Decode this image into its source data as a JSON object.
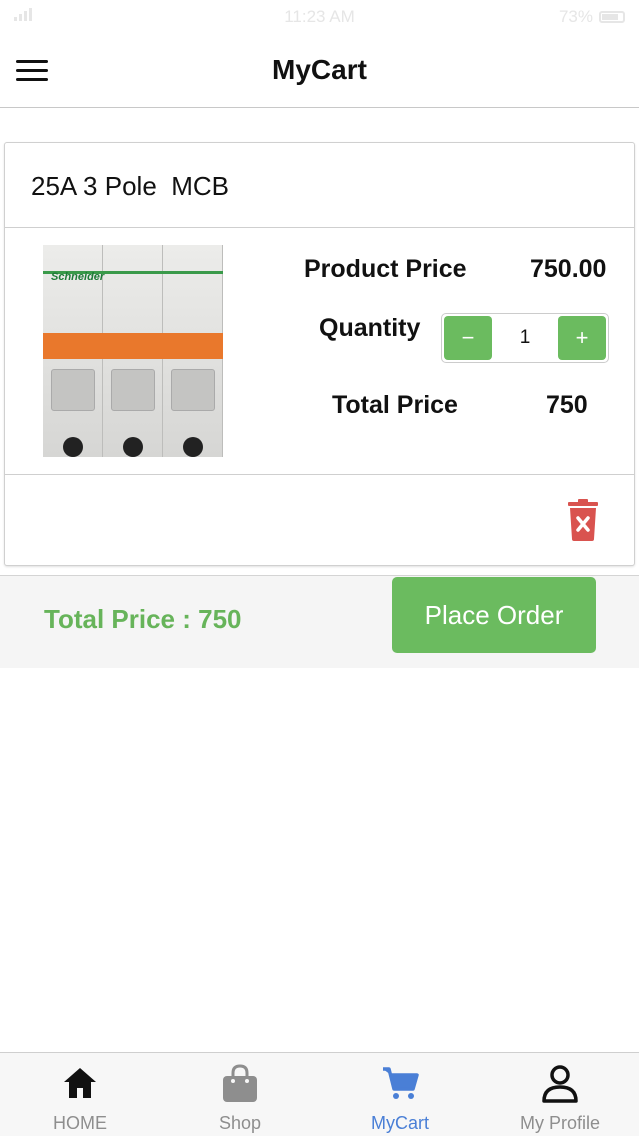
{
  "status_bar": {
    "time": "11:23 AM",
    "battery": "73%"
  },
  "header": {
    "title": "MyCart",
    "menu_icon": "hamburger-menu-icon"
  },
  "cart_item": {
    "name": "25A 3 Pole  MCB",
    "image_brand": "Schneider",
    "product_price_label": "Product Price",
    "product_price": "750.00",
    "quantity_label": "Quantity",
    "quantity": "1",
    "decrement_label": "−",
    "increment_label": "+",
    "total_price_label": "Total Price",
    "total_price": "750",
    "delete_icon": "trash-icon"
  },
  "footer": {
    "total_text": "Total Price : 750",
    "place_order_label": "Place Order"
  },
  "tabs": [
    {
      "label": "HOME",
      "icon": "home-icon",
      "active": false
    },
    {
      "label": "Shop",
      "icon": "shopping-bag-icon",
      "active": false
    },
    {
      "label": "MyCart",
      "icon": "cart-icon",
      "active": true
    },
    {
      "label": "My Profile",
      "icon": "user-icon",
      "active": false
    }
  ],
  "colors": {
    "accent_green": "#6bbb5f",
    "total_green": "#67b45a",
    "active_tab_blue": "#4a7fd6",
    "delete_red": "#d9534f"
  }
}
